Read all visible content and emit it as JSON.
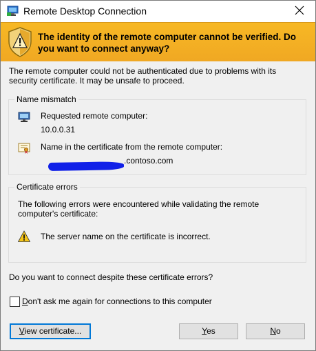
{
  "window": {
    "title": "Remote Desktop Connection"
  },
  "banner": {
    "message": "The identity of the remote computer cannot be verified. Do you want to connect anyway?"
  },
  "intro": "The remote computer could not be authenticated due to problems with its security certificate. It may be unsafe to proceed.",
  "name_mismatch": {
    "legend": "Name mismatch",
    "requested_label": "Requested remote computer:",
    "requested_value": "10.0.0.31",
    "cert_label": "Name in the certificate from the remote computer:",
    "cert_value_suffix": ".contoso.com"
  },
  "cert_errors": {
    "legend": "Certificate errors",
    "description": "The following errors were encountered while validating the remote computer's certificate:",
    "error_text": "The server name on the certificate is incorrect."
  },
  "question": "Do you want to connect despite these certificate errors?",
  "dont_ask": {
    "label_prefix": "D",
    "label_rest": "on't ask me again for connections to this computer",
    "checked": false
  },
  "buttons": {
    "view_cert_prefix": "V",
    "view_cert_rest": "iew certificate...",
    "yes_prefix": "Y",
    "yes_rest": "es",
    "no_prefix": "N",
    "no_rest": "o"
  },
  "colors": {
    "banner": "#f7b824",
    "redaction": "#1020e8",
    "default_button_border": "#0078d7"
  }
}
